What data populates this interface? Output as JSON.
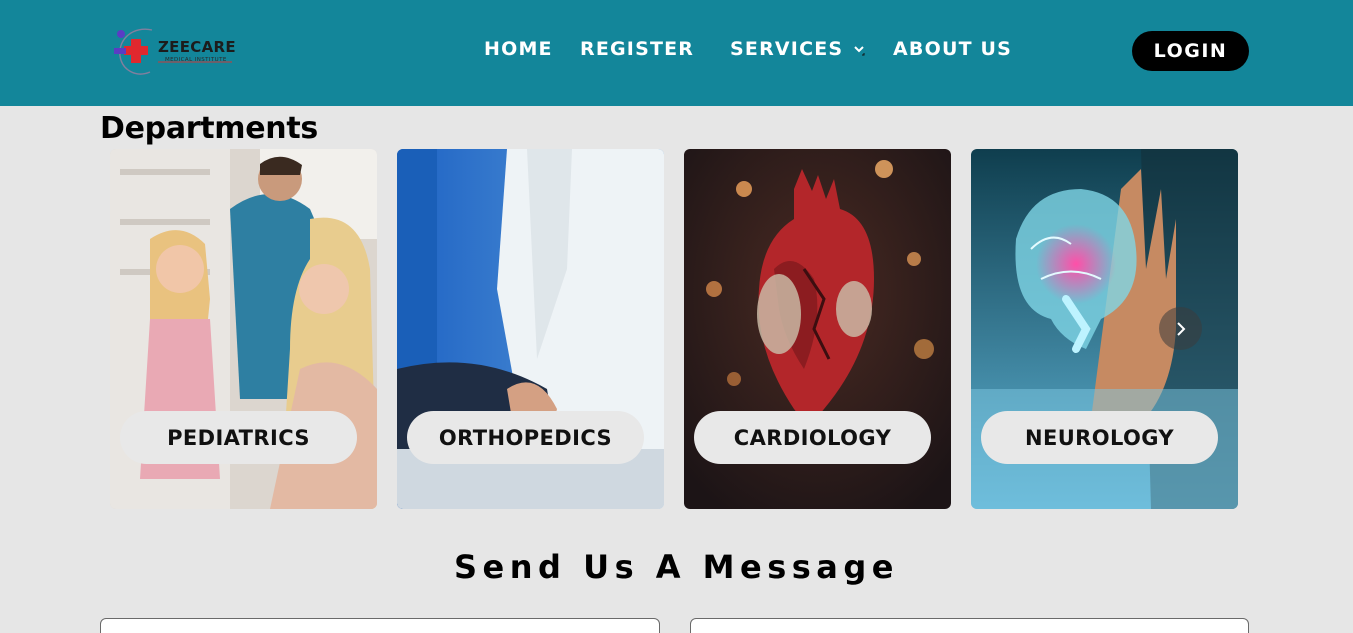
{
  "brand": {
    "name": "ZEECARE",
    "tagline": "MEDICAL INSTITUTE",
    "colors": {
      "navbar": "#13869a",
      "red": "#e0282e",
      "purple": "#5b3cc4"
    }
  },
  "nav": {
    "home": "HOME",
    "register": "REGISTER",
    "services": "SERVICES",
    "about": "ABOUT US",
    "login": "LOGIN"
  },
  "departments": {
    "title": "Departments",
    "items": [
      {
        "label": "PEDIATRICS"
      },
      {
        "label": "ORTHOPEDICS"
      },
      {
        "label": "CARDIOLOGY"
      },
      {
        "label": "NEUROLOGY"
      }
    ],
    "next_icon": "chevron-right-icon"
  },
  "message": {
    "title": "Send Us A Message"
  }
}
